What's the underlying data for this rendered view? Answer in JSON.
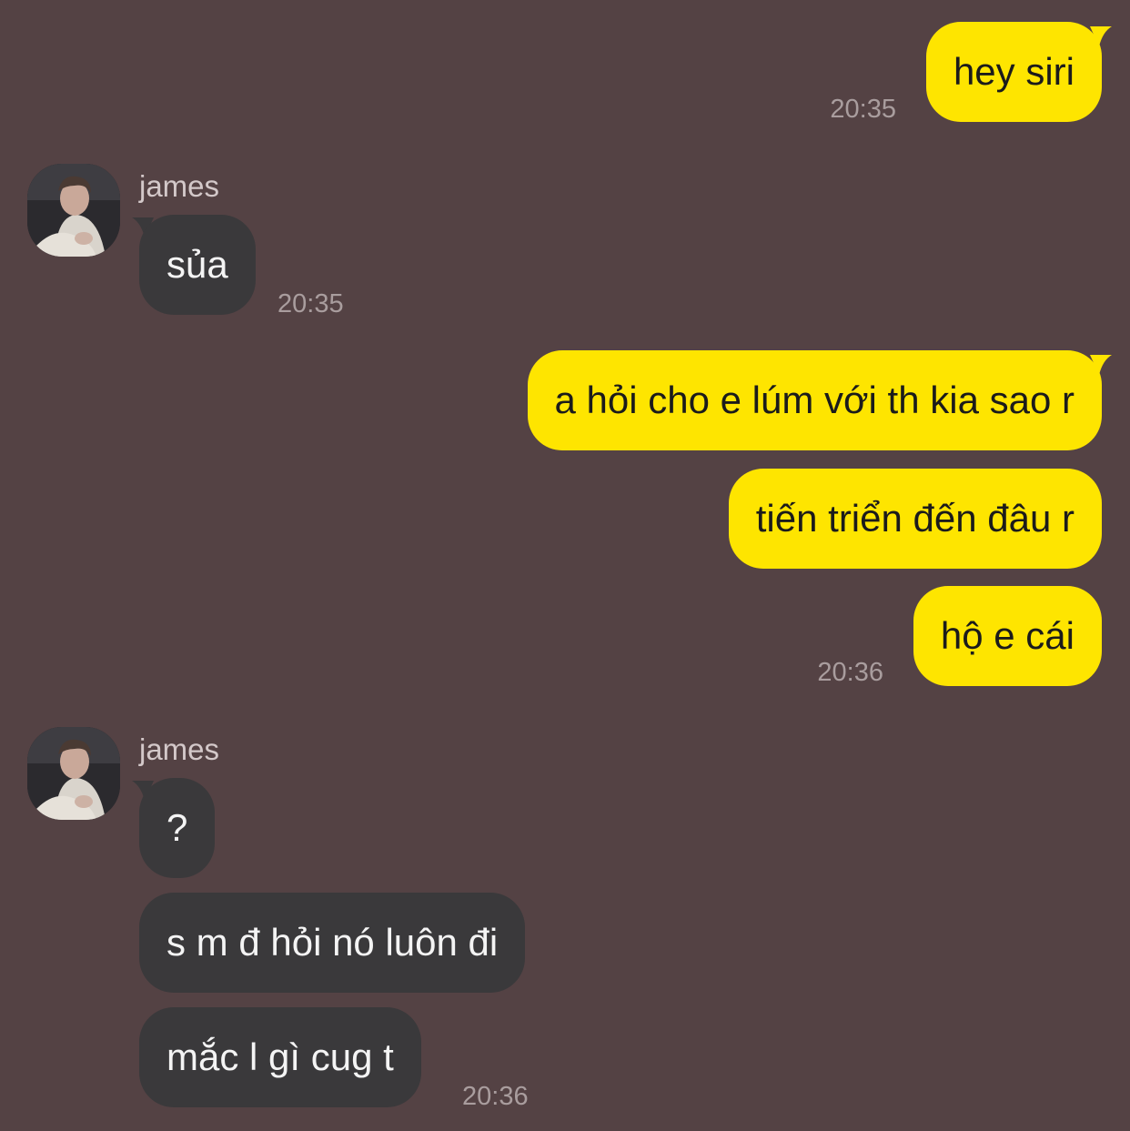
{
  "colors": {
    "background": "#544244",
    "outgoing_bubble": "#FEE500",
    "incoming_bubble": "#3a393b",
    "timestamp": "#a99d9e"
  },
  "messages": [
    {
      "direction": "outgoing",
      "text": "hey siri",
      "time": "20:35"
    },
    {
      "direction": "incoming",
      "sender": "james",
      "avatar": "user-avatar-photo",
      "text": "sủa",
      "time": "20:35"
    },
    {
      "direction": "outgoing",
      "text": "a hỏi cho e lúm với th kia sao r"
    },
    {
      "direction": "outgoing",
      "text": "tiến triển đến đâu r"
    },
    {
      "direction": "outgoing",
      "text": "hộ e cái",
      "time": "20:36"
    },
    {
      "direction": "incoming",
      "sender": "james",
      "avatar": "user-avatar-photo",
      "text": "?"
    },
    {
      "direction": "incoming",
      "text": "s m đ hỏi nó luôn đi"
    },
    {
      "direction": "incoming",
      "text": "mắc l gì cug t",
      "time": "20:36"
    }
  ]
}
